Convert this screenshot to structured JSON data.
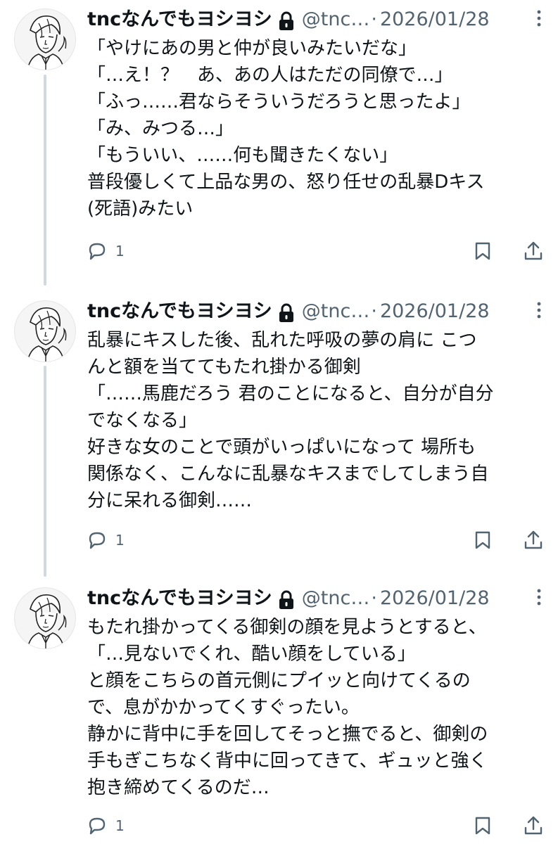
{
  "tweets": [
    {
      "display_name": "tncなんでもヨシヨシ",
      "handle": "@tnc…",
      "separator": "·",
      "date": "2026/01/28",
      "lines": [
        "「やけにあの男と仲が良いみたいだな」",
        "「…え！？　あ、あの人はただの同僚で…」",
        "「ふっ……君ならそういうだろうと思ったよ」",
        "「み、みつる…」",
        "「もういい、……何も聞きたくない」",
        "普段優しくて上品な男の、怒り任せの乱暴Dキス",
        "(死語)みたい"
      ],
      "reply_count": "1"
    },
    {
      "display_name": "tncなんでもヨシヨシ",
      "handle": "@tnc…",
      "separator": "·",
      "date": "2026/01/28",
      "lines": [
        "乱暴にキスした後、乱れた呼吸の夢の肩に こつ",
        "んと額を当ててもたれ掛かる御剣",
        "「……馬鹿だろう 君のことになると、自分が自分",
        "でなくなる」",
        "好きな女のことで頭がいっぱいになって 場所も",
        "関係なく、こんなに乱暴なキスまでしてしまう自",
        "分に呆れる御剣……"
      ],
      "reply_count": "1"
    },
    {
      "display_name": "tncなんでもヨシヨシ",
      "handle": "@tnc…",
      "separator": "·",
      "date": "2026/01/28",
      "lines": [
        "もたれ掛かってくる御剣の顔を見ようとすると、",
        "「…見ないでくれ、酷い顔をしている」",
        "と顔をこちらの首元側にプイッと向けてくるの",
        "で、息がかかってくすぐったい。",
        "静かに背中に手を回してそっと撫でると、御剣の",
        "手もぎこちなく背中に回ってきて、ギュッと強く",
        "抱き締めてくるのだ…"
      ],
      "reply_count": "1"
    }
  ],
  "icons": {
    "lock": "lock-icon",
    "more": "more-icon",
    "reply": "reply-icon",
    "bookmark": "bookmark-icon",
    "share": "share-icon",
    "avatar": "avatar"
  },
  "colors": {
    "text": "#0f1419",
    "secondary": "#536471",
    "thread_line": "#cfd9de",
    "background": "#ffffff"
  }
}
